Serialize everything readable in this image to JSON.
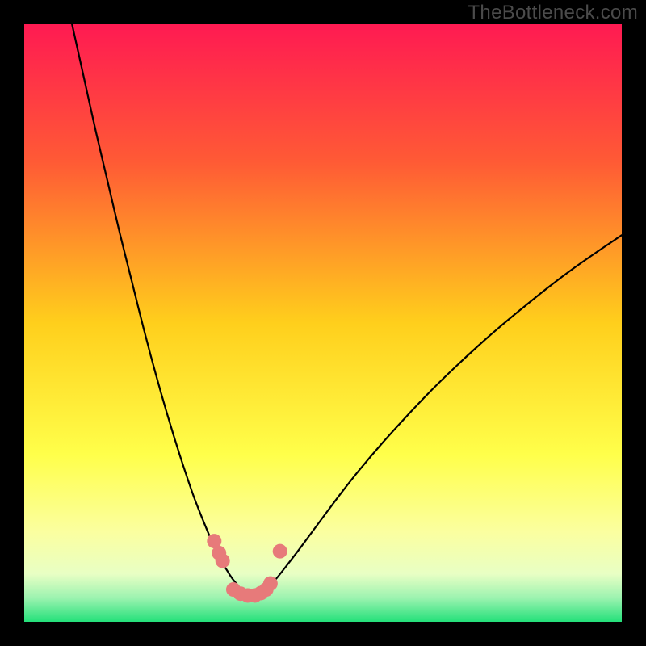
{
  "watermark": "TheBottleneck.com",
  "chart_data": {
    "type": "line",
    "title": "",
    "xlabel": "",
    "ylabel": "",
    "xlim": [
      0,
      100
    ],
    "ylim": [
      0,
      100
    ],
    "grid": false,
    "legend": false,
    "background_gradient": {
      "top": "#ff1a52",
      "mid_upper": "#ff6a2a",
      "mid": "#ffd81f",
      "mid_lower": "#ffff5a",
      "low_band": "#f5ffb5",
      "bottom": "#28e57c"
    },
    "series": [
      {
        "name": "left-curve",
        "color": "#000000",
        "width": 2.2,
        "x": [
          8,
          10,
          12,
          14,
          16,
          18,
          20,
          22,
          24,
          26,
          28,
          29,
          30,
          31,
          32,
          33,
          33.5,
          34,
          34.5,
          35,
          35.5
        ],
        "y": [
          100,
          91,
          82,
          73.5,
          65,
          57,
          49,
          41.5,
          34.5,
          28,
          22,
          19.3,
          16.8,
          14.4,
          12.2,
          10.2,
          9.3,
          8.5,
          7.7,
          7.0,
          6.4
        ]
      },
      {
        "name": "right-curve",
        "color": "#000000",
        "width": 2.2,
        "x": [
          41,
          42,
          44,
          46,
          48,
          50,
          53,
          56,
          60,
          64,
          68,
          72,
          76,
          80,
          84,
          88,
          92,
          96,
          100
        ],
        "y": [
          6.0,
          7.0,
          9.5,
          12.1,
          14.8,
          17.5,
          21.5,
          25.3,
          30.0,
          34.4,
          38.6,
          42.5,
          46.2,
          49.7,
          53.0,
          56.2,
          59.2,
          62.0,
          64.7
        ]
      },
      {
        "name": "floor",
        "color": "#000000",
        "width": 2.2,
        "x": [
          35.5,
          36.5,
          37.5,
          38.5,
          39.5,
          41
        ],
        "y": [
          6.4,
          5.2,
          4.6,
          4.6,
          5.0,
          6.0
        ]
      }
    ],
    "markers": [
      {
        "name": "dots",
        "color": "#e77a7a",
        "radius_px": 9,
        "points": [
          {
            "x": 31.8,
            "y": 13.5
          },
          {
            "x": 32.6,
            "y": 11.5
          },
          {
            "x": 33.2,
            "y": 10.2
          },
          {
            "x": 35.0,
            "y": 5.4
          },
          {
            "x": 36.2,
            "y": 4.7
          },
          {
            "x": 37.4,
            "y": 4.4
          },
          {
            "x": 38.6,
            "y": 4.4
          },
          {
            "x": 39.6,
            "y": 4.8
          },
          {
            "x": 40.5,
            "y": 5.4
          },
          {
            "x": 41.2,
            "y": 6.4
          },
          {
            "x": 42.8,
            "y": 11.8
          }
        ]
      }
    ]
  }
}
